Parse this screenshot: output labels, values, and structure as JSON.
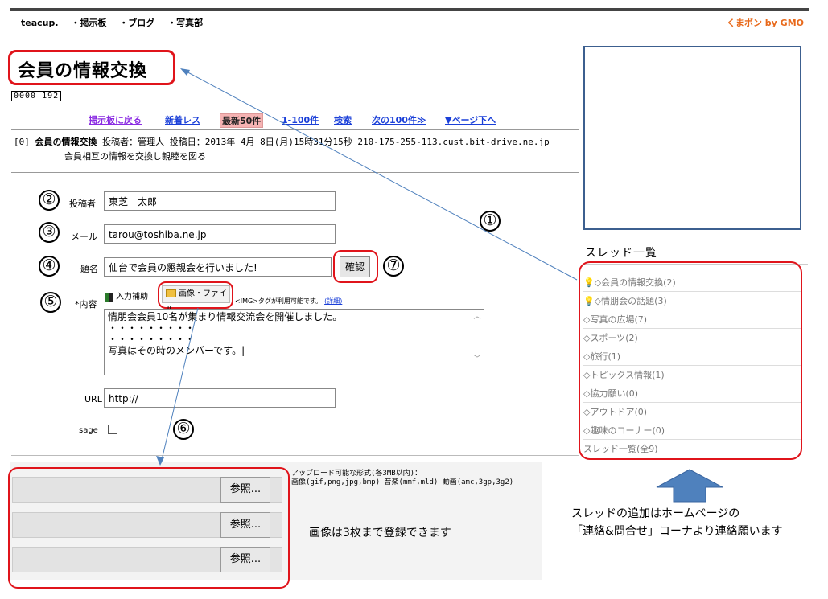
{
  "header": {
    "nav": [
      "teacup.",
      "・掲示板",
      "・ブログ",
      "・写真部"
    ],
    "brand": "くまポン by GMO"
  },
  "board": {
    "title": "会員の情報交換",
    "counter": "0000 192"
  },
  "navlinks": [
    "掲示板に戻る",
    "新着レス",
    "最新50件",
    "1-100件",
    "検索",
    "次の100件≫",
    "▼ページ下へ"
  ],
  "post": {
    "prefix": "[0]",
    "title": "会員の情報交換",
    "meta": "投稿者：管理人 投稿日：2013年 4月 8日(月)15時31分15秒 210-175-255-113.cust.bit-drive.ne.jp",
    "body": "会員相互の情報を交換し親睦を図る"
  },
  "form": {
    "author_label": "投稿者",
    "author_value": "東芝　太郎",
    "mail_label": "メール",
    "mail_value": "tarou@toshiba.ne.jp",
    "subject_label": "題名",
    "subject_value": "仙台で会員の懇親会を行いました!",
    "confirm_button": "確認",
    "content_label": "*内容",
    "helper_button": "入力補助",
    "image_button": "画像・ファイル",
    "tag_note": "<IMG>タグが利用可能です。",
    "tag_link": "(詳細)",
    "content_value": "情朋会会員10名が集まり情報交流会を開催しました。\n・・・・・・・・・\n・・・・・・・・・\n写真はその時のメンバーです。|",
    "url_label": "URL",
    "url_value": "http://",
    "sage_label": "sage"
  },
  "upload": {
    "note_line1": "アップロード可能な形式(各3MB以内)：",
    "note_line2": "画像(gif,png,jpg,bmp) 音楽(mmf,mld) 動画(amc,3gp,3g2)",
    "browse_label": "参照...",
    "rows": 3
  },
  "threads": {
    "title": "スレッド一覧",
    "items": [
      "◇会員の情報交換(2)",
      "◇情朋会の話題(3)",
      "◇写真の広場(7)",
      "◇スポーツ(2)",
      "◇旅行(1)",
      "◇トピックス情報(1)",
      "◇協力願い(0)",
      "◇アウトドア(0)",
      "◇趣味のコーナー(0)",
      "スレッド一覧(全9)"
    ]
  },
  "annotations": {
    "markers": [
      "①",
      "②",
      "③",
      "④",
      "⑤",
      "⑥",
      "⑦"
    ],
    "image_note": "画像は3枚まで登録できます",
    "thread_note_line1": "スレッドの追加はホームページの",
    "thread_note_line2": "「連絡&問合せ」コーナより連絡願います"
  },
  "colors": {
    "annotation_red": "#e0141b",
    "link_blue": "#1a3fd8",
    "brand_orange": "#e8691b",
    "arrow_blue": "#4f81bd"
  }
}
